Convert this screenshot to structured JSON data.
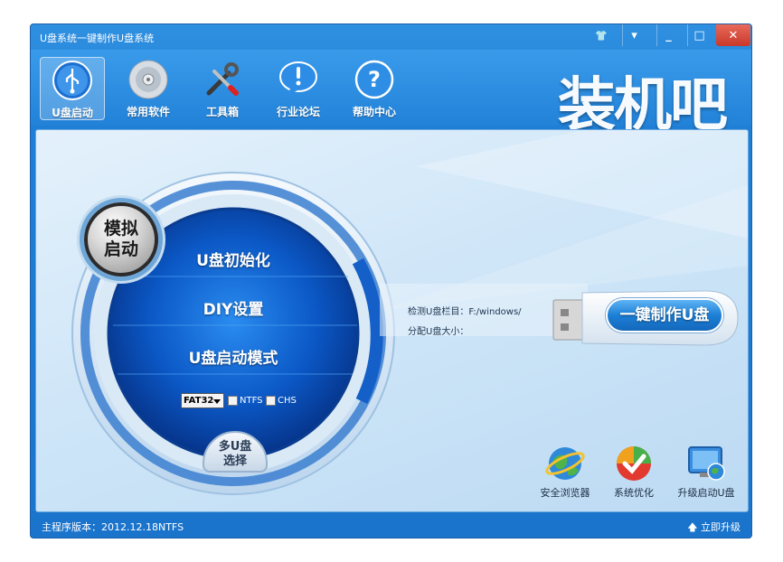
{
  "window": {
    "title": "U盘系统一键制作U盘系统"
  },
  "title_buttons": [
    {
      "name": "skin",
      "glyph": "👕"
    },
    {
      "name": "menu",
      "glyph": "▾"
    },
    {
      "name": "minimize",
      "glyph": "_"
    },
    {
      "name": "maximize",
      "glyph": "□"
    },
    {
      "name": "close",
      "glyph": "✕"
    }
  ],
  "toolbar": {
    "items": [
      {
        "label": "U盘启动",
        "icon": "usb-icon",
        "active": true
      },
      {
        "label": "常用软件",
        "icon": "disc-icon",
        "active": false
      },
      {
        "label": "工具箱",
        "icon": "tools-icon",
        "active": false
      },
      {
        "label": "行业论坛",
        "icon": "forum-icon",
        "active": false
      },
      {
        "label": "帮助中心",
        "icon": "help-icon",
        "active": false
      }
    ],
    "brand": "装机吧"
  },
  "main": {
    "simulate_button": {
      "line1": "模拟",
      "line2": "启动"
    },
    "menu": [
      "U盘初始化",
      "DIY设置",
      "U盘启动模式"
    ],
    "format": {
      "selected": "FAT32",
      "ntfs": "NTFS",
      "chs": "CHS"
    },
    "multi_select": {
      "line1": "多U盘",
      "line2": "选择"
    },
    "detect_label": "检测U盘栏目：F:/windows/",
    "alloc_label": "分配U盘大小：",
    "make_button": "一键制作U盘",
    "quick_actions": [
      {
        "label": "安全浏览器",
        "icon": "browser-icon"
      },
      {
        "label": "系统优化",
        "icon": "optimize-icon"
      },
      {
        "label": "升级启动U盘",
        "icon": "upgrade-usb-icon"
      }
    ]
  },
  "status": {
    "version": "主程序版本：2012.12.18NTFS",
    "upgrade": "立即升级"
  },
  "colors": {
    "accent": "#1f7fd6",
    "panel": "#cfe6f8",
    "ring": "#0f56b8"
  }
}
